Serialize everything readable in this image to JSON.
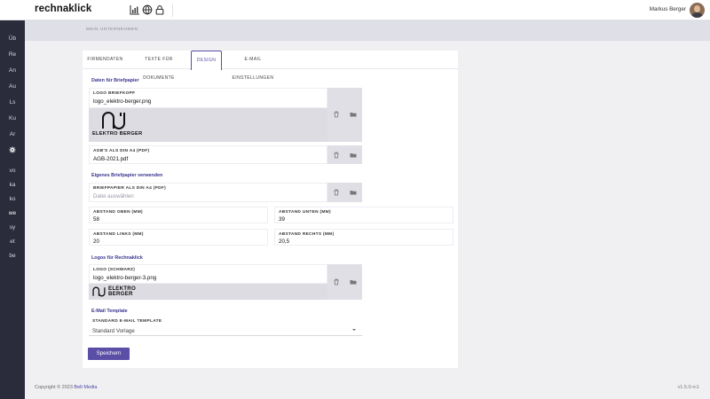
{
  "app": {
    "brand": "rechnaklick"
  },
  "header": {
    "user_name": "Markus Berger"
  },
  "sidebar": {
    "top_items": [
      "Üb",
      "Re",
      "An",
      "Au",
      "Ls",
      "Ku",
      "Ar"
    ],
    "bottom_items": [
      "vo",
      "ka",
      "ko",
      "we",
      "sy",
      "et",
      "be"
    ]
  },
  "breadcrumb": "MEIN UNTERNEHMEN",
  "tabs": [
    {
      "label": "FIRMENDATEN"
    },
    {
      "label": "TEXTE FÜR DOKUMENTE"
    },
    {
      "label": "DESIGN"
    },
    {
      "label": "E-MAIL EINSTELLUNGEN"
    }
  ],
  "sections": {
    "briefpapier": "Daten für Briefpapier",
    "eigenes": "Eigenes Briefpapier verwenden",
    "logos": "Logos für Rechnaklick",
    "email": "E-Mail Template"
  },
  "fields": {
    "logo_briefkopf": {
      "label": "LOGO BRIEFKOPF",
      "value": "logo_elektro-berger.png"
    },
    "agbs": {
      "label": "AGB'S ALS DIN A4 (PDF)",
      "value": "AGB-2021.pdf"
    },
    "briefpapier": {
      "label": "BRIEFPAPIER ALS DIN A4 (PDF)",
      "placeholder": "Datei auswählen"
    },
    "abstand_oben": {
      "label": "ABSTAND OBEN (MM)",
      "value": "58"
    },
    "abstand_unten": {
      "label": "ABSTAND UNTEN (MM)",
      "value": "39"
    },
    "abstand_links": {
      "label": "ABSTAND LINKS (MM)",
      "value": "20"
    },
    "abstand_rechts": {
      "label": "ABSTAND RECHTS (MM)",
      "value": "20,5"
    },
    "logo_schwarz": {
      "label": "LOGO (SCHWARZ)",
      "value": "logo_elektro-berger-3.png"
    },
    "email_template": {
      "label": "STANDARD E-MAIL TEMPLATE",
      "value": "Standard Vorlage"
    }
  },
  "logo": {
    "text1": "ELEKTRO BERGER",
    "text2a": "ELEKTRO",
    "text2b": "BERGER"
  },
  "save_label": "Speichern",
  "footer": {
    "copyright": "Copyright © 2023",
    "company": "Belt Media",
    "version": "v1.5.0-rc1"
  },
  "colors": {
    "accent": "#5a4ea6",
    "sidebar": "#2a2c3b",
    "section_title": "#3b3690"
  }
}
